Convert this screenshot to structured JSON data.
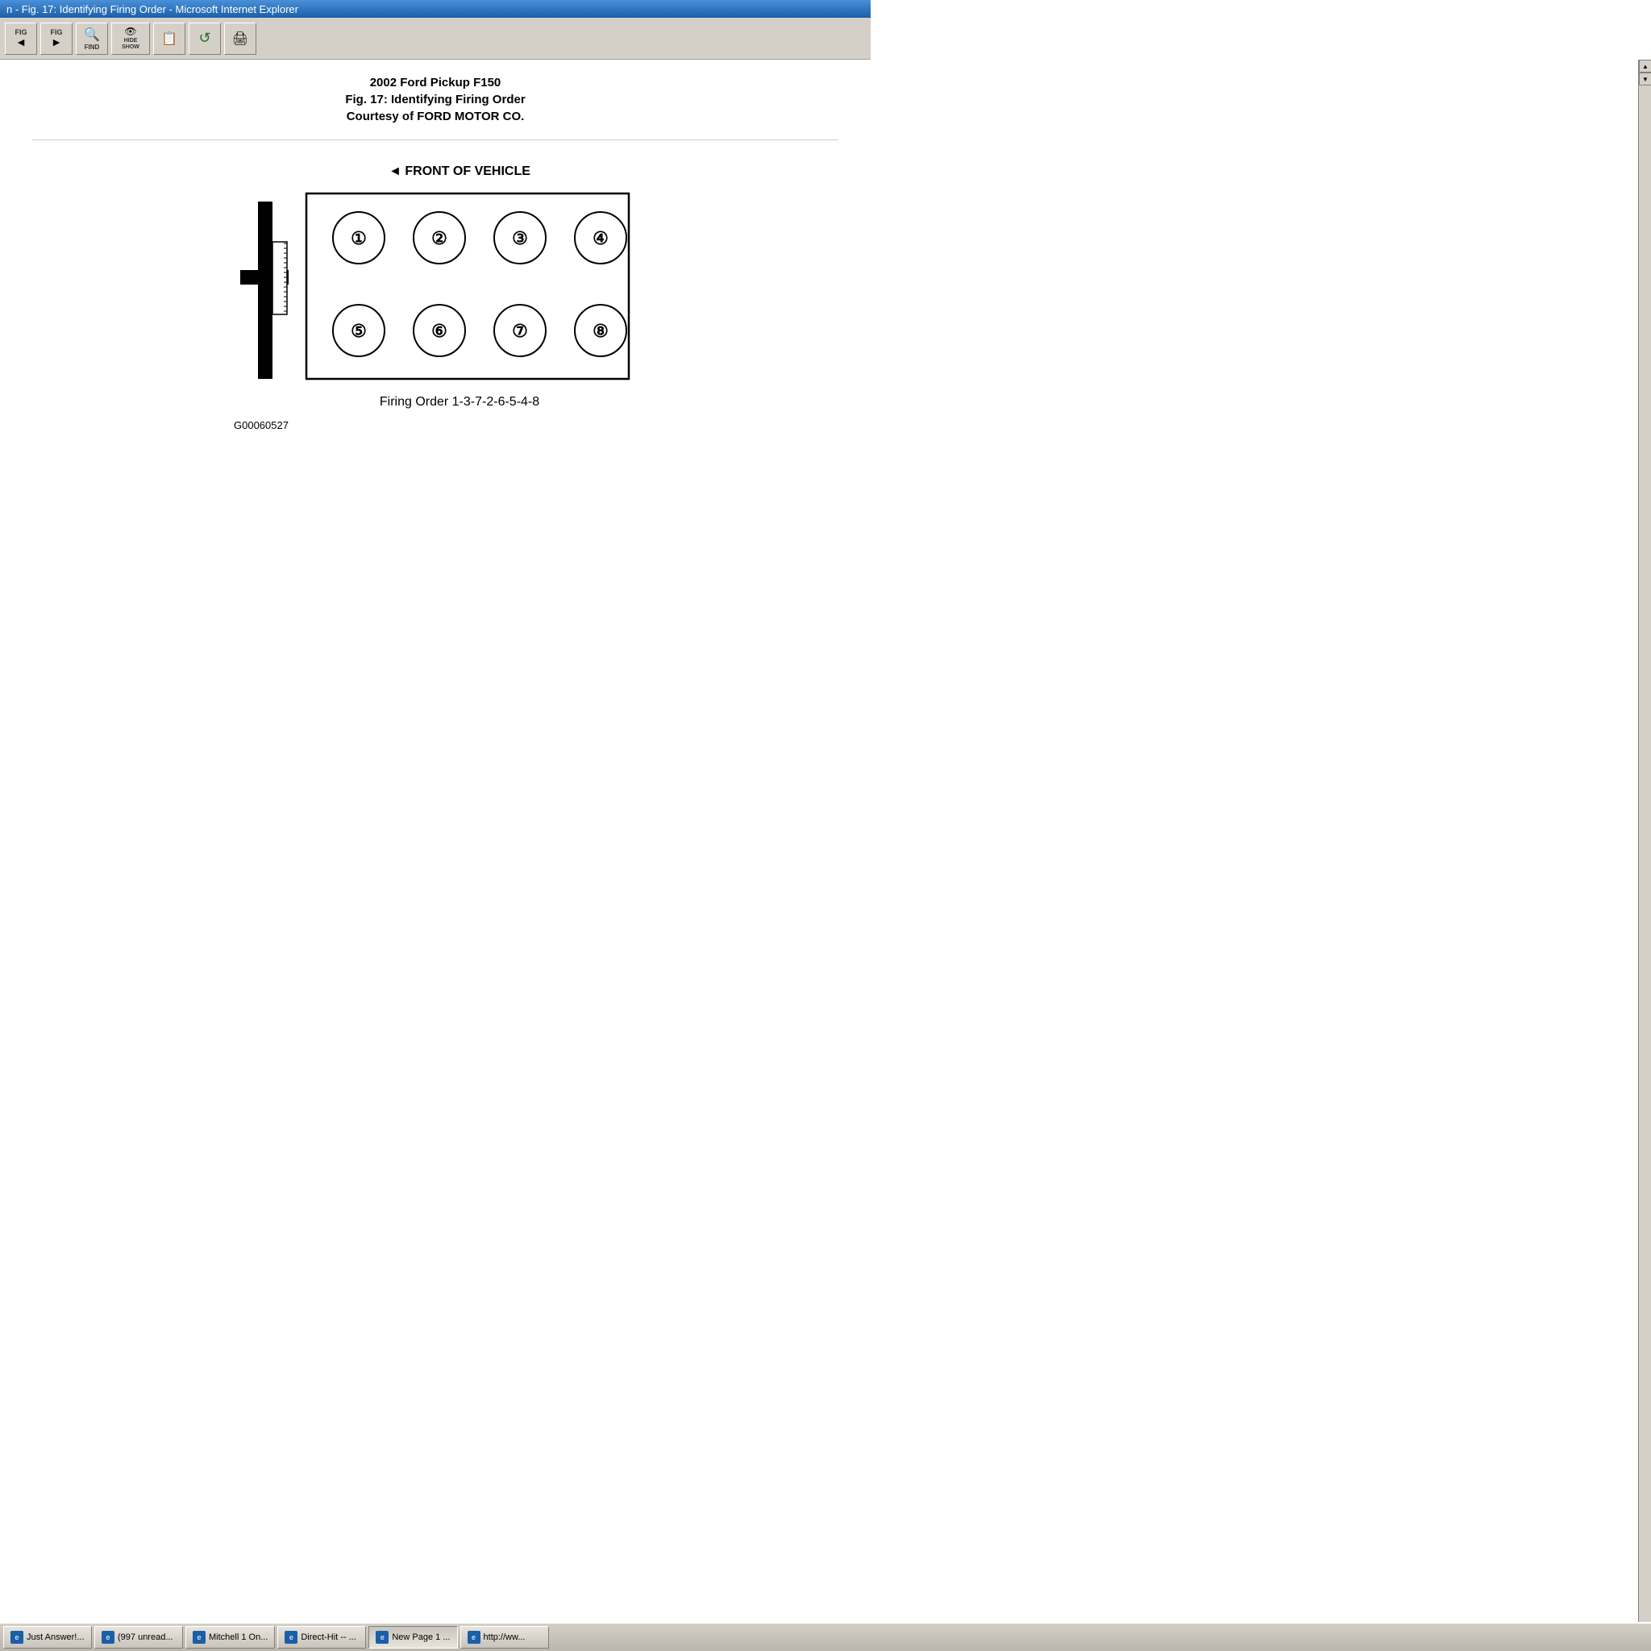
{
  "titleBar": {
    "text": "n - Fig. 17: Identifying Firing Order - Microsoft Internet Explorer"
  },
  "toolbar": {
    "buttons": [
      {
        "id": "btn-fig-prev",
        "icon": "FIG",
        "label": "",
        "type": "fig-arrow-left"
      },
      {
        "id": "btn-fig-next",
        "icon": "FIG",
        "label": "",
        "type": "fig-arrow-right"
      },
      {
        "id": "btn-find",
        "icon": "🔍",
        "label": "FIND",
        "type": "find"
      },
      {
        "id": "btn-hide-show",
        "icon": "👁",
        "label": "HIDE SHOW",
        "type": "hide-show"
      },
      {
        "id": "btn-note",
        "icon": "📝",
        "label": "",
        "type": "note"
      },
      {
        "id": "btn-refresh",
        "icon": "↺",
        "label": "",
        "type": "refresh"
      },
      {
        "id": "btn-print",
        "icon": "🖨",
        "label": "",
        "type": "print"
      }
    ]
  },
  "pageTitle": "2002 Ford Pickup F150",
  "figTitle": "Fig. 17: Identifying Firing Order",
  "courtesy": "Courtesy of FORD MOTOR CO.",
  "diagram": {
    "frontLabel": "◄ FRONT OF VEHICLE",
    "cylinders": [
      {
        "num": "①",
        "row": "top",
        "col": 1
      },
      {
        "num": "②",
        "row": "top",
        "col": 2
      },
      {
        "num": "③",
        "row": "top",
        "col": 3
      },
      {
        "num": "④",
        "row": "top",
        "col": 4
      },
      {
        "num": "⑤",
        "row": "bottom",
        "col": 1
      },
      {
        "num": "⑥",
        "row": "bottom",
        "col": 2
      },
      {
        "num": "⑦",
        "row": "bottom",
        "col": 3
      },
      {
        "num": "⑧",
        "row": "bottom",
        "col": 4
      }
    ],
    "firingOrder": "Firing Order 1-3-7-2-6-5-4-8",
    "partNumber": "G00060527"
  },
  "taskbar": {
    "buttons": [
      {
        "id": "taskbar-justanswer",
        "label": "Just Answer!...",
        "icon": "e"
      },
      {
        "id": "taskbar-997unread",
        "label": "(997 unread...",
        "icon": "e"
      },
      {
        "id": "taskbar-mitchell",
        "label": "Mitchell 1 On...",
        "icon": "e"
      },
      {
        "id": "taskbar-directhit",
        "label": "Direct-Hit -- ...",
        "icon": "e"
      },
      {
        "id": "taskbar-newpage1",
        "label": "New Page 1 ...",
        "icon": "e"
      },
      {
        "id": "taskbar-http",
        "label": "http://ww...",
        "icon": "e"
      }
    ]
  }
}
